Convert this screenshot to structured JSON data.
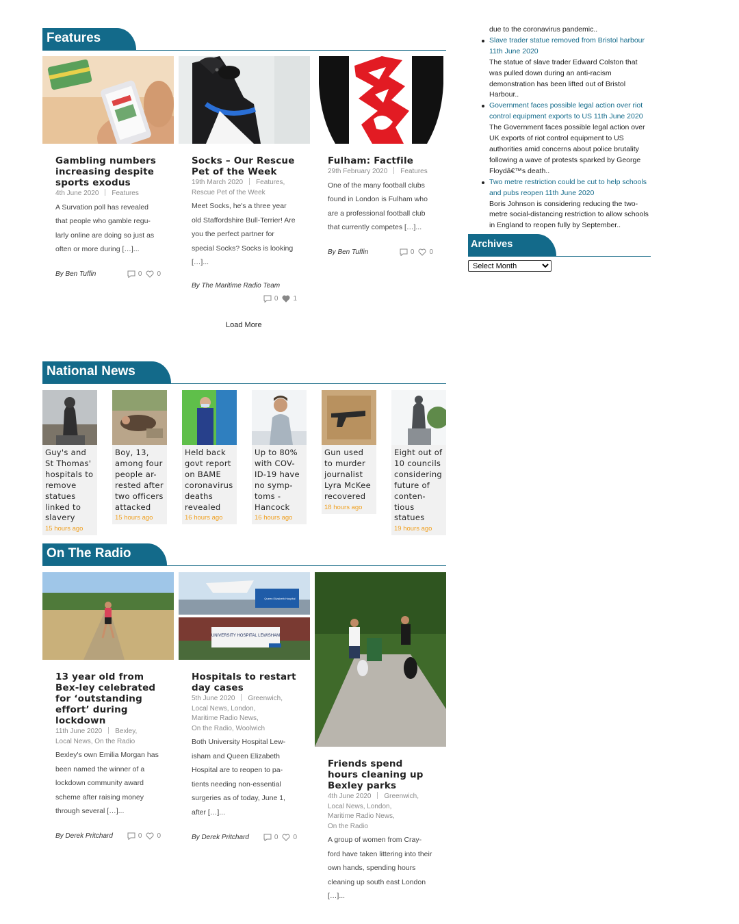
{
  "sections": {
    "features": "Features",
    "national": "National News",
    "radio": "On The Radio",
    "archives": "Archives"
  },
  "features": [
    {
      "title": "Gambling numbers increasing despite sports exodus",
      "date": "4th June 2020",
      "category": "Features",
      "excerpt": "A Survation poll has revealed that people who gamble regu-larly online are doing so just as often or more during […]...",
      "author": "By Ben Tuffin",
      "comments": "0",
      "likes": "0"
    },
    {
      "title": "Socks – Our Rescue Pet of the Week",
      "date": "19th March 2020",
      "category": "Features,",
      "category2": "Rescue Pet of the Week",
      "excerpt": "Meet Socks, he's a three year old Staffordshire Bull-Terrier! Are you the perfect partner for special Socks? Socks is looking […]...",
      "author": "By The Maritime Radio Team",
      "comments": "0",
      "likes": "1"
    },
    {
      "title": "Fulham: Factfile",
      "date": "29th February 2020",
      "category": "Features",
      "excerpt": "One of the many football clubs found in London is Fulham who are a professional football club that currently competes […]...",
      "author": "By Ben Tuffin",
      "comments": "0",
      "likes": "0"
    }
  ],
  "load_more": "Load More",
  "national_news": [
    {
      "title": "Guy's and St Thomas' hospitals to remove statues linked to slavery",
      "time": "15 hours ago"
    },
    {
      "title": "Boy, 13, among four people ar-rested after two officers attacked",
      "time": "15 hours ago"
    },
    {
      "title": "Held back govt report on BAME coronavirus deaths revealed",
      "time": "16 hours ago"
    },
    {
      "title": "Up to 80% with COV-ID-19 have no symp-toms - Hancock",
      "time": "16 hours ago"
    },
    {
      "title": "Gun used to murder journalist Lyra McKee recovered",
      "time": "18 hours ago"
    },
    {
      "title": "Eight out of 10 councils considering future of conten-tious statues",
      "time": "19 hours ago"
    }
  ],
  "radio": [
    {
      "title": "13 year old from Bex-ley celebrated for ‘outstanding effort’ during lockdown",
      "date": "11th June 2020",
      "category": "Bexley,",
      "category2": "Local News, On the Radio",
      "excerpt": "Bexley's own Emilia Morgan has been named the winner of a lockdown community award scheme after raising money through several […]...",
      "author": "By Derek Pritchard",
      "comments": "0",
      "likes": "0"
    },
    {
      "title": "Hospitals to restart day cases",
      "date": "5th June 2020",
      "category": "Greenwich,",
      "category2": "Local News, London,",
      "category3": "Maritime Radio News,",
      "category4": "On the Radio, Woolwich",
      "excerpt": "Both University Hospital Lew-isham and Queen Elizabeth Hospital are to reopen to pa-tients needing non-essential surgeries as of today, June 1, after […]...",
      "author": "By Derek Pritchard",
      "comments": "0",
      "likes": "0",
      "sign1": "Queen Elizabeth Hospital",
      "sign2": "UNIVERSITY HOSPITAL LEWISHAM"
    },
    {
      "title": "Friends spend hours cleaning up Bexley parks",
      "date": "4th June 2020",
      "category": "Greenwich,",
      "category2": "Local News, London,",
      "category3": "Maritime Radio News,",
      "category4": "On the Radio",
      "excerpt": "A group of women from Cray-ford have taken littering into their own hands, spending hours cleaning up south east London […]..."
    }
  ],
  "sidebar": {
    "top_desc": "due to the coronavirus pandemic..",
    "items": [
      {
        "link": "Slave trader statue removed from Bristol harbour 11th June 2020",
        "desc": "The statue of slave trader Edward Colston that was pulled down during an anti-racism demonstration has been lifted out of Bristol Harbour.."
      },
      {
        "link": "Government faces possible legal action over riot control equipment exports to US 11th June 2020",
        "desc": "The Government faces possible legal action over UK exports of riot control equipment to US authorities amid concerns about police brutality following a wave of protests sparked by George Floydâ€™s death.."
      },
      {
        "link": "Two metre restriction could be cut to help schools and pubs reopen 11th June 2020",
        "desc": "Boris Johnson is considering reducing the two-metre social-distancing restriction to allow schools in England to reopen fully by September.."
      }
    ],
    "archives_select": "Select Month"
  },
  "colors": {
    "accent": "#136a8a",
    "time": "#f0a020"
  }
}
